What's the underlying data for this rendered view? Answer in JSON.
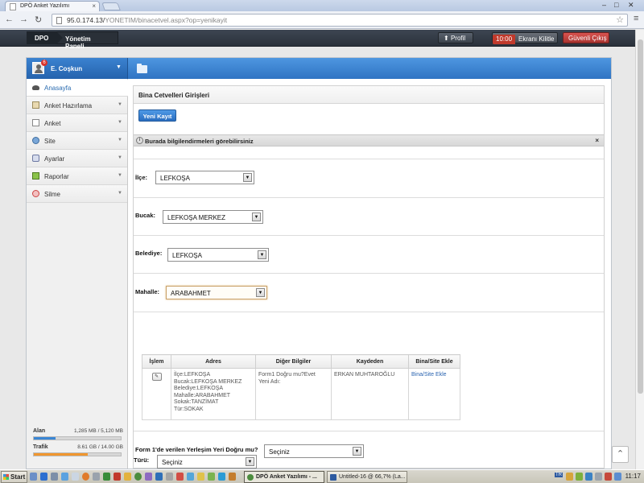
{
  "browser": {
    "tab_title": "DPÖ Anket Yazılımı",
    "url_host": "95.0.174.13/",
    "url_path": "YONETIM/binacetvel.aspx?op=yenikayit"
  },
  "header": {
    "crumb_home": "DPO",
    "crumb_panel": "Yönetim Paneli",
    "profile_label": "Profil",
    "timer": "10:00",
    "lock_label": "Ekranı Kilitle",
    "logout_label": "Güvenli Çıkış"
  },
  "user": {
    "name": "E. Coşkun",
    "notification_count": "6"
  },
  "sidebar": {
    "items": [
      {
        "label": "Anasayfa",
        "icon": "home-icon"
      },
      {
        "label": "Anket Hazırlama",
        "icon": "box-icon"
      },
      {
        "label": "Anket",
        "icon": "card-icon"
      },
      {
        "label": "Site",
        "icon": "globe-icon"
      },
      {
        "label": "Ayarlar",
        "icon": "gear-icon"
      },
      {
        "label": "Raporlar",
        "icon": "report-icon"
      },
      {
        "label": "Silme",
        "icon": "delete-icon"
      }
    ],
    "usage": [
      {
        "label": "Alan",
        "value": "1,285 MB / 5,120 MB",
        "fraction": 0.25,
        "color": "#3a86d4"
      },
      {
        "label": "Trafik",
        "value": "8.61 GB / 14.00 GB",
        "fraction": 0.62,
        "color": "#f0962e"
      }
    ]
  },
  "main": {
    "section_title": "Bina Cetvelleri Girişleri",
    "new_record_label": "Yeni Kayıt",
    "info_text": "Burada bilgilendirmeleri görebilirsiniz",
    "info_close": "×",
    "fields": {
      "ilce": {
        "label": "İlçe:",
        "value": "LEFKOŞA"
      },
      "bucak": {
        "label": "Bucak:",
        "value": "LEFKOŞA MERKEZ"
      },
      "belediye": {
        "label": "Belediye:",
        "value": "LEFKOŞA"
      },
      "mahalle": {
        "label": "Mahalle:",
        "value": "ARABAHMET"
      },
      "form1": {
        "label": "Form 1'de verilen Yerleşim Yeri Doğru mu?",
        "value": "Seçiniz"
      },
      "turu": {
        "label": "Türü:",
        "value": "Seçiniz"
      }
    },
    "table": {
      "headers": [
        "İşlem",
        "Adres",
        "Diğer Bilgiler",
        "Kaydeden",
        "Bina/Site Ekle"
      ],
      "rows": [
        {
          "adres": [
            "İlçe:LEFKOŞA",
            "Bucak:LEFKOŞA MERKEZ",
            "Belediye:LEFKOŞA",
            "Mahalle:ARABAHMET",
            "Sokak:TANZİMAT",
            "Tür:SOKAK"
          ],
          "diger": [
            "Form1 Doğru mu?Evet",
            "Yeni Adı:"
          ],
          "kaydeden": "ERKAN MUHTAROĞLU",
          "ekle": "Bina/Site Ekle"
        }
      ]
    }
  },
  "taskbar": {
    "start_label": "Start",
    "tasks": [
      {
        "label": "DPÖ Anket Yazılımı - ...",
        "active": true
      },
      {
        "label": "Untitled-16 @ 66,7% (La...",
        "active": false
      }
    ],
    "lang": "TR",
    "clock": "11:17"
  }
}
